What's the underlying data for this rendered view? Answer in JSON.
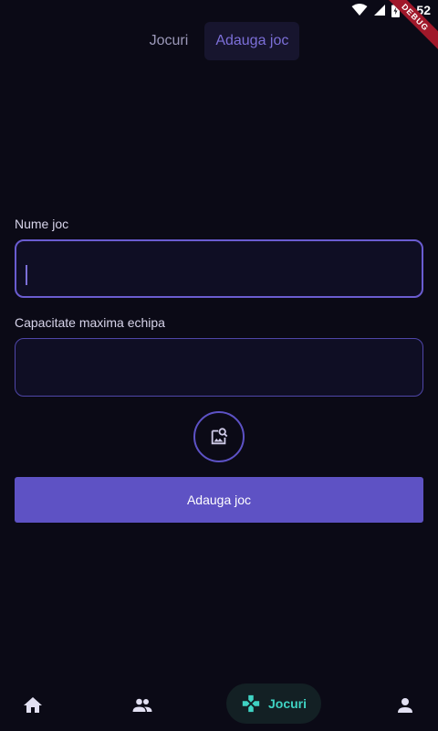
{
  "status_bar": {
    "time": "9:52",
    "debug_label": "DEBUG"
  },
  "tabs": [
    {
      "label": "Jocuri",
      "active": false
    },
    {
      "label": "Adauga joc",
      "active": true
    }
  ],
  "form": {
    "fields": [
      {
        "label": "Nume joc",
        "value": "",
        "focused": true
      },
      {
        "label": "Capacitate maxima echipa",
        "value": "",
        "focused": false
      }
    ],
    "image_picker_icon": "image-search-icon",
    "submit_label": "Adauga joc"
  },
  "bottom_nav": {
    "items": [
      {
        "icon": "home-icon",
        "label": ""
      },
      {
        "icon": "people-icon",
        "label": ""
      },
      {
        "icon": "gamepad-icon",
        "label": "Jocuri",
        "active": true
      },
      {
        "icon": "person-icon",
        "label": ""
      }
    ]
  },
  "colors": {
    "background": "#0b0a16",
    "accent": "#5e52c4",
    "nav_active": "#3fd3c3"
  }
}
